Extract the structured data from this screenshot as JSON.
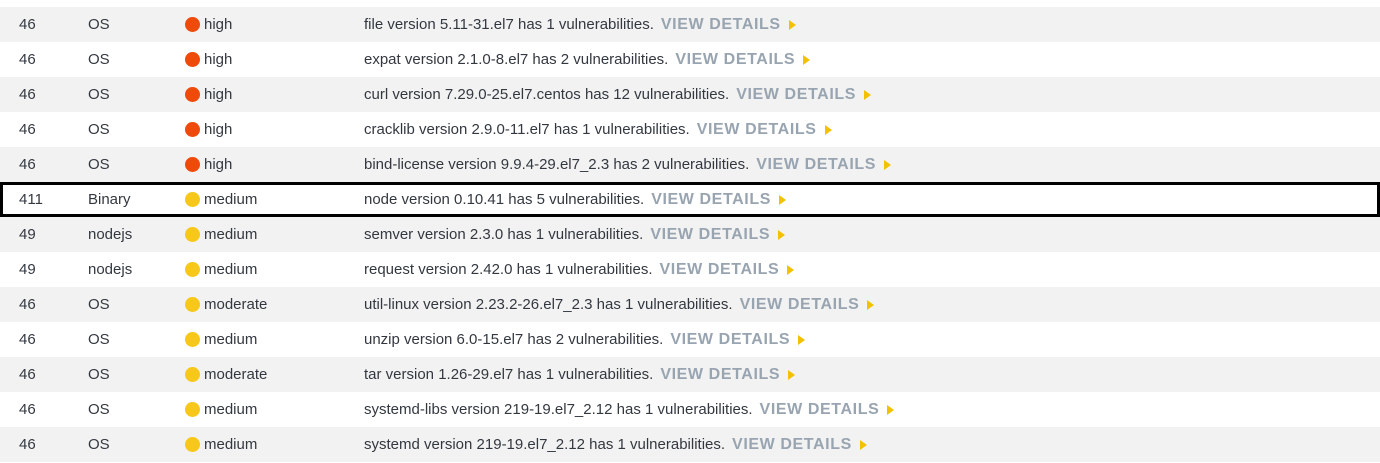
{
  "colors": {
    "high": "#f04a0a",
    "medium": "#f7c81a",
    "link": "#98a4b0",
    "arrow": "#f2c200"
  },
  "link_label": "VIEW DETAILS",
  "rows": [
    {
      "num": "46",
      "type": "OS",
      "severity": "high",
      "desc": "file version 5.11-31.el7 has 1 vulnerabilities."
    },
    {
      "num": "46",
      "type": "OS",
      "severity": "high",
      "desc": "expat version 2.1.0-8.el7 has 2 vulnerabilities."
    },
    {
      "num": "46",
      "type": "OS",
      "severity": "high",
      "desc": "curl version 7.29.0-25.el7.centos has 12 vulnerabilities."
    },
    {
      "num": "46",
      "type": "OS",
      "severity": "high",
      "desc": "cracklib version 2.9.0-11.el7 has 1 vulnerabilities."
    },
    {
      "num": "46",
      "type": "OS",
      "severity": "high",
      "desc": "bind-license version 9.9.4-29.el7_2.3 has 2 vulnerabilities."
    },
    {
      "num": "411",
      "type": "Binary",
      "severity": "medium",
      "desc": "node version 0.10.41 has 5 vulnerabilities.",
      "selected": true
    },
    {
      "num": "49",
      "type": "nodejs",
      "severity": "medium",
      "desc": "semver version 2.3.0 has 1 vulnerabilities."
    },
    {
      "num": "49",
      "type": "nodejs",
      "severity": "medium",
      "desc": "request version 2.42.0 has 1 vulnerabilities."
    },
    {
      "num": "46",
      "type": "OS",
      "severity": "moderate",
      "desc": "util-linux version 2.23.2-26.el7_2.3 has 1 vulnerabilities."
    },
    {
      "num": "46",
      "type": "OS",
      "severity": "medium",
      "desc": "unzip version 6.0-15.el7 has 2 vulnerabilities."
    },
    {
      "num": "46",
      "type": "OS",
      "severity": "moderate",
      "desc": "tar version 1.26-29.el7 has 1 vulnerabilities."
    },
    {
      "num": "46",
      "type": "OS",
      "severity": "medium",
      "desc": "systemd-libs version 219-19.el7_2.12 has 1 vulnerabilities."
    },
    {
      "num": "46",
      "type": "OS",
      "severity": "medium",
      "desc": "systemd version 219-19.el7_2.12 has 1 vulnerabilities."
    }
  ]
}
